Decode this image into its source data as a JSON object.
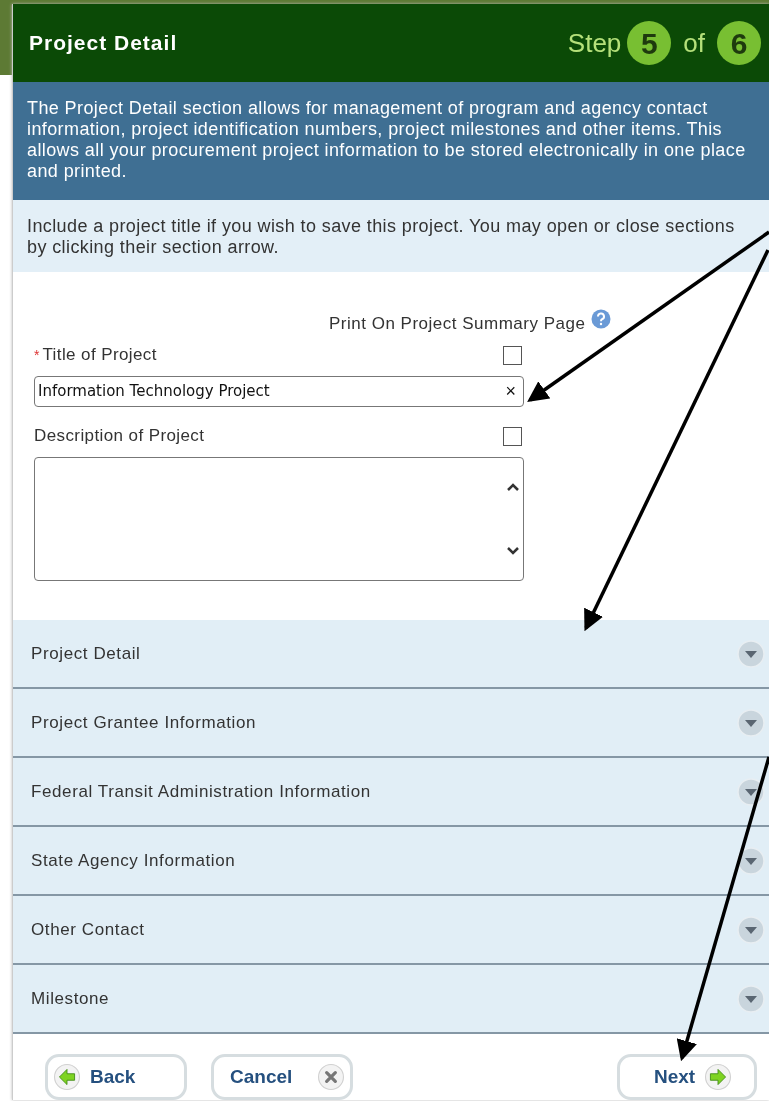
{
  "header": {
    "title": "Project Detail",
    "step_label": "Step",
    "current_step": "5",
    "of_label": "of",
    "total_steps": "6"
  },
  "intro": "The Project Detail section allows for management of program and agency contact information, project identification numbers, project milestones and other items. This allows all your procurement project information to be stored electronically in one place and printed.",
  "instructions": "Include a project title if you wish to save this project. You may open or close sections by clicking their section arrow.",
  "print_label": "Print On Project Summary Page",
  "fields": [
    {
      "kind": "input",
      "required_mark": "*",
      "label": "Title of Project",
      "print_checked": false,
      "value": "Information Technology Project",
      "clear_glyph": "×"
    },
    {
      "kind": "textarea",
      "label": "Description of Project",
      "print_checked": false
    }
  ],
  "sections": [
    {
      "label": "Project Detail",
      "expanded": false
    },
    {
      "label": "Project Grantee Information",
      "expanded": false
    },
    {
      "label": "Federal Transit Administration Information",
      "expanded": false
    },
    {
      "label": "State Agency Information",
      "expanded": false
    },
    {
      "label": "Other Contact",
      "expanded": false
    },
    {
      "label": "Milestone",
      "expanded": false
    }
  ],
  "buttons": [
    {
      "kind": "back",
      "label": "Back"
    },
    {
      "kind": "cancel",
      "label": "Cancel"
    },
    {
      "kind": "next",
      "label": "Next"
    }
  ]
}
